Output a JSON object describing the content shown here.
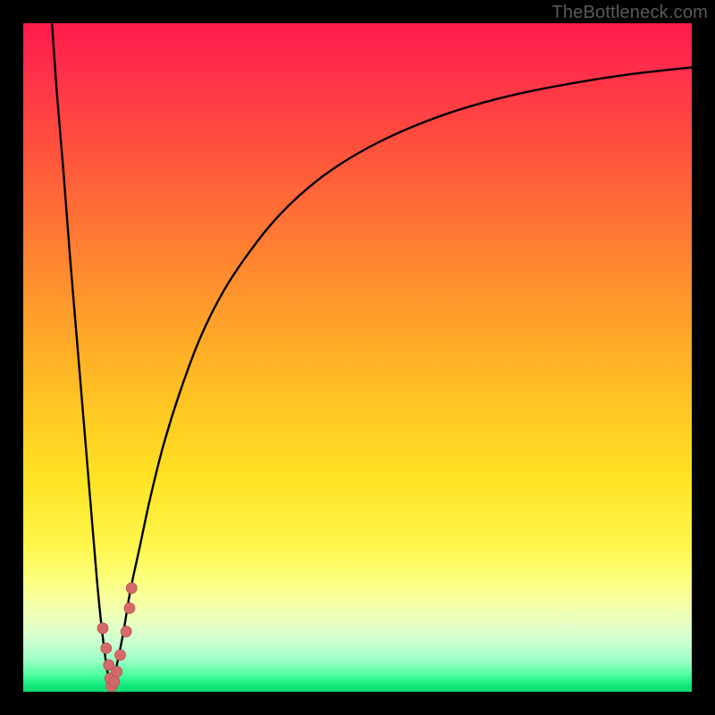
{
  "watermark": "TheBottleneck.com",
  "colors": {
    "curve_stroke": "#000000",
    "marker_fill": "#d46a6a",
    "marker_stroke": "#b84f4f"
  },
  "chart_data": {
    "type": "line",
    "title": "",
    "xlabel": "",
    "ylabel": "",
    "xlim": [
      0,
      100
    ],
    "ylim": [
      0,
      100
    ],
    "grid": false,
    "legend": false,
    "series": [
      {
        "name": "left-descent",
        "x": [
          4.3,
          5.0,
          6.0,
          7.0,
          8.0,
          9.0,
          10.0,
          11.0,
          11.8,
          12.6,
          13.2
        ],
        "y": [
          100,
          90,
          78,
          65,
          53,
          41,
          29,
          17,
          9,
          3,
          0.5
        ]
      },
      {
        "name": "right-ascent",
        "x": [
          13.2,
          14.0,
          15.0,
          16.0,
          17.5,
          19.0,
          21.0,
          23.5,
          26.5,
          30.0,
          34.0,
          38.5,
          44.0,
          50.0,
          57.0,
          65.0,
          73.0,
          82.0,
          91.0,
          100.0
        ],
        "y": [
          0.5,
          4,
          9,
          15,
          22,
          29,
          37,
          45,
          53,
          60,
          66,
          71.5,
          76.5,
          80.5,
          84,
          87,
          89.2,
          91,
          92.4,
          93.4
        ]
      }
    ],
    "markers": [
      {
        "x": 11.9,
        "y": 9.5,
        "r": 6
      },
      {
        "x": 12.4,
        "y": 6.5,
        "r": 6
      },
      {
        "x": 12.8,
        "y": 4.0,
        "r": 6
      },
      {
        "x": 13.0,
        "y": 2.0,
        "r": 6
      },
      {
        "x": 13.2,
        "y": 0.8,
        "r": 6
      },
      {
        "x": 13.6,
        "y": 1.5,
        "r": 6
      },
      {
        "x": 14.0,
        "y": 3.0,
        "r": 6
      },
      {
        "x": 14.5,
        "y": 5.5,
        "r": 6
      },
      {
        "x": 15.4,
        "y": 9.0,
        "r": 6
      },
      {
        "x": 15.9,
        "y": 12.5,
        "r": 6
      },
      {
        "x": 16.2,
        "y": 15.5,
        "r": 6
      }
    ]
  }
}
